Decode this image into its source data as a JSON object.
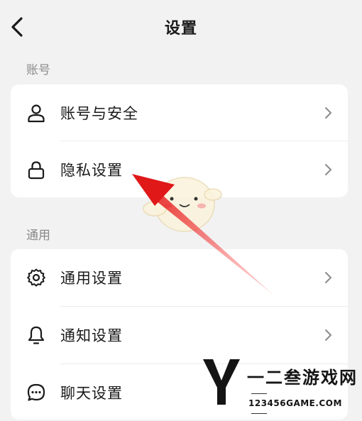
{
  "header": {
    "title": "设置",
    "back_icon": "chevron-left-icon"
  },
  "sections": [
    {
      "label": "账号",
      "items": [
        {
          "label": "账号与安全",
          "icon": "person-icon"
        },
        {
          "label": "隐私设置",
          "icon": "lock-icon"
        }
      ]
    },
    {
      "label": "通用",
      "items": [
        {
          "label": "通用设置",
          "icon": "gear-icon"
        },
        {
          "label": "通知设置",
          "icon": "bell-icon"
        },
        {
          "label": "聊天设置",
          "icon": "chat-bubble-icon"
        }
      ]
    }
  ],
  "annotation": {
    "arrow_color": "#e02020"
  },
  "watermark": {
    "brand": "一二叁游戏网",
    "url": "123456GAME.COM"
  }
}
